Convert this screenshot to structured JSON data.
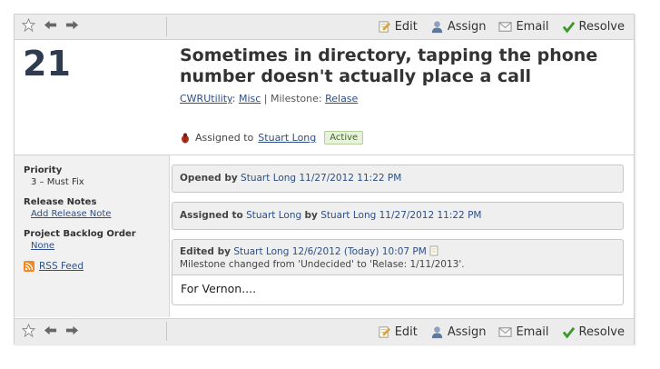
{
  "toolbar": {
    "edit_label": "Edit",
    "assign_label": "Assign",
    "email_label": "Email",
    "resolve_label": "Resolve"
  },
  "case": {
    "number": "21",
    "title": "Sometimes in directory, tapping the phone number doesn't actually place a call",
    "project": "CWRUtility",
    "area": "Misc",
    "milestone_label": "Milestone:",
    "milestone": "Relase",
    "assigned_prefix": "Assigned to",
    "assignee": "Stuart Long",
    "status": "Active"
  },
  "sidebar": {
    "priority_label": "Priority",
    "priority_value": "3 – Must Fix",
    "release_notes_label": "Release Notes",
    "release_notes_link": "Add Release Note",
    "backlog_label": "Project Backlog Order",
    "backlog_value": "None",
    "rss_label": "RSS Feed"
  },
  "events": [
    {
      "action": "Opened by",
      "who": "Stuart Long",
      "when": "11/27/2012 11:22 PM"
    },
    {
      "action": "Assigned to",
      "who": "Stuart Long",
      "by_label": "by",
      "by_who": "Stuart Long",
      "when": "11/27/2012 11:22 PM"
    },
    {
      "action": "Edited by",
      "who": "Stuart Long",
      "when": "12/6/2012 (Today) 10:07 PM",
      "change": "Milestone changed from 'Undecided' to 'Relase: 1/11/2013'.",
      "comment": "For Vernon...."
    }
  ],
  "colors": {
    "title": "#2e3a4e",
    "link": "#2d4f84",
    "active_badge": "#e7f1dc"
  },
  "icons": [
    "star-icon",
    "back-arrow-icon",
    "forward-arrow-icon",
    "edit-icon",
    "assign-icon",
    "email-icon",
    "resolve-check-icon",
    "bug-icon",
    "rss-icon",
    "note-icon"
  ]
}
